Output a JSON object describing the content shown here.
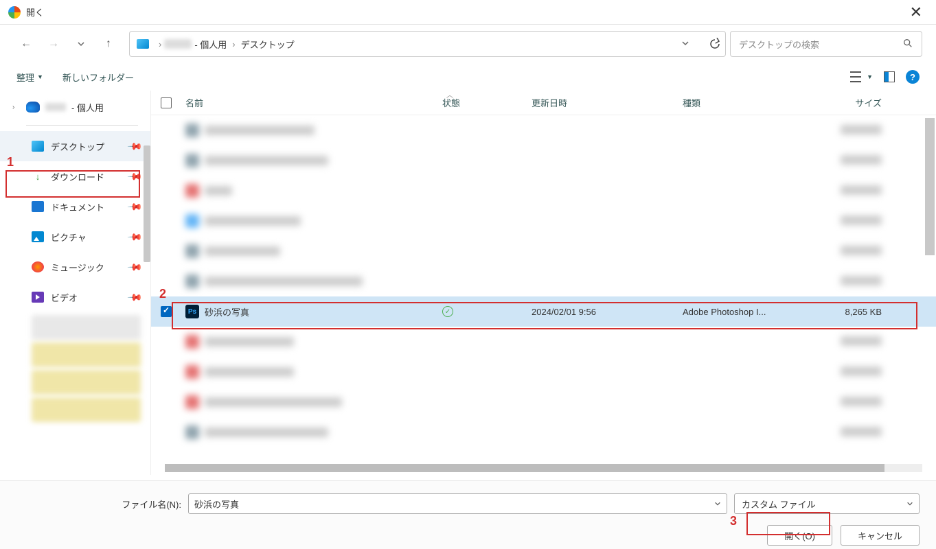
{
  "window": {
    "title": "開く"
  },
  "nav": {
    "breadcrumb_personal_suffix": " - 個人用",
    "breadcrumb_desktop": "デスクトップ"
  },
  "search": {
    "placeholder": "デスクトップの検索"
  },
  "toolbar": {
    "organize": "整理",
    "new_folder": "新しいフォルダー"
  },
  "sidebar": {
    "onedrive_suffix": " - 個人用",
    "desktop": "デスクトップ",
    "downloads": "ダウンロード",
    "documents": "ドキュメント",
    "pictures": "ピクチャ",
    "music": "ミュージック",
    "videos": "ビデオ"
  },
  "columns": {
    "name": "名前",
    "status": "状態",
    "date": "更新日時",
    "type": "種類",
    "size": "サイズ"
  },
  "selected_file": {
    "name": "砂浜の写真",
    "date": "2024/02/01 9:56",
    "type": "Adobe Photoshop I...",
    "size": "8,265 KB"
  },
  "footer": {
    "filename_label": "ファイル名(N):",
    "filename_value": "砂浜の写真",
    "filetype": "カスタム ファイル",
    "open": "開く(O)",
    "cancel": "キャンセル"
  },
  "annotations": {
    "n1": "1",
    "n2": "2",
    "n3": "3"
  }
}
